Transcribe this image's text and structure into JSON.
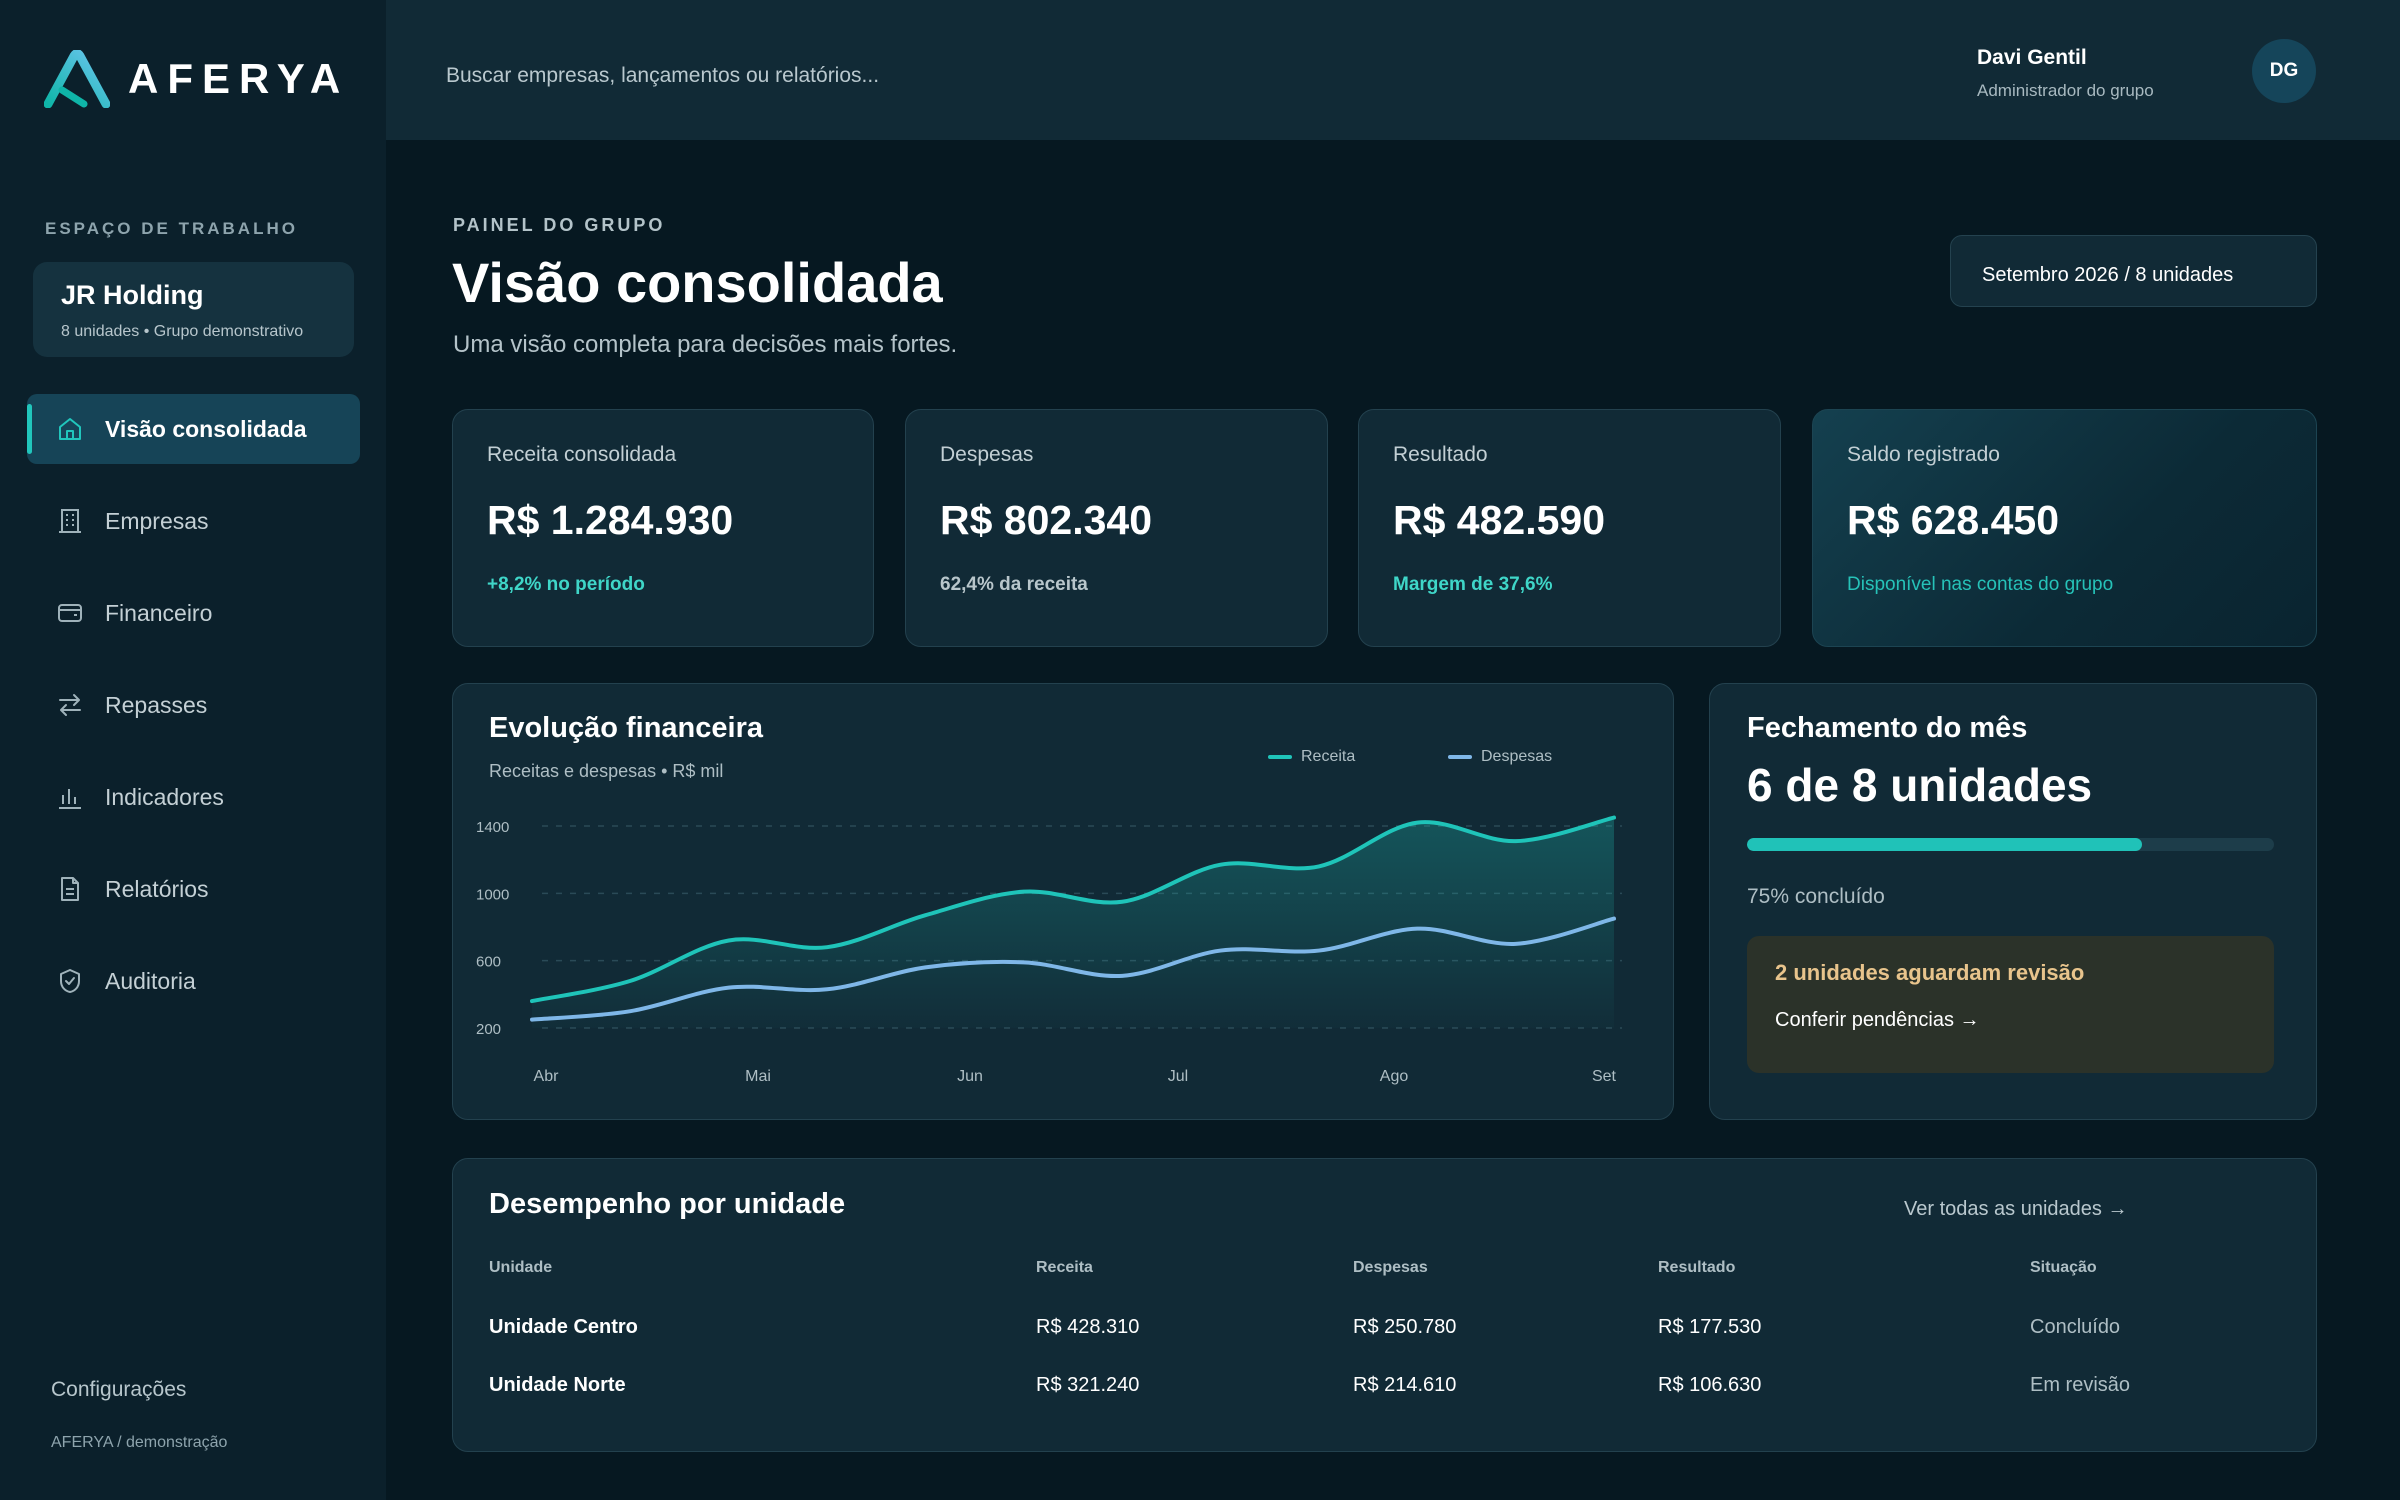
{
  "brand": {
    "name": "AFERYA",
    "accent": "#21c6bc"
  },
  "sidebar": {
    "workspace_label": "ESPAÇO DE TRABALHO",
    "workspace": {
      "name": "JR Holding",
      "subtitle": "8 unidades • Grupo demonstrativo"
    },
    "items": [
      {
        "label": "Visão consolidada",
        "icon": "home-icon",
        "active": true
      },
      {
        "label": "Empresas",
        "icon": "building-icon",
        "active": false
      },
      {
        "label": "Financeiro",
        "icon": "wallet-icon",
        "active": false
      },
      {
        "label": "Repasses",
        "icon": "transfer-icon",
        "active": false
      },
      {
        "label": "Indicadores",
        "icon": "bar-chart-icon",
        "active": false
      },
      {
        "label": "Relatórios",
        "icon": "document-icon",
        "active": false
      },
      {
        "label": "Auditoria",
        "icon": "shield-check-icon",
        "active": false
      }
    ],
    "settings_label": "Configurações",
    "footnote": "AFERYA / demonstração"
  },
  "topbar": {
    "search_placeholder": "Buscar empresas, lançamentos ou relatórios...",
    "user": {
      "name": "Davi Gentil",
      "role": "Administrador do grupo",
      "initials": "DG"
    }
  },
  "header": {
    "eyebrow": "PAINEL DO GRUPO",
    "title": "Visão consolidada",
    "subtitle": "Uma visão completa para decisões mais fortes.",
    "period": "Setembro 2026 / 8 unidades"
  },
  "kpis": [
    {
      "label": "Receita consolidada",
      "value": "R$ 1.284.930",
      "note": "+8,2% no período",
      "note_color": "#3fd6c8"
    },
    {
      "label": "Despesas",
      "value": "R$ 802.340",
      "note": "62,4% da receita",
      "note_color": "#b8c6cb"
    },
    {
      "label": "Resultado",
      "value": "R$ 482.590",
      "note": "Margem de 37,6%",
      "note_color": "#3fd6c8"
    },
    {
      "label": "Saldo registrado",
      "value": "R$ 628.450",
      "note": "Disponível nas contas do grupo",
      "note_color": "#26c2b8"
    }
  ],
  "chart": {
    "title": "Evolução financeira",
    "subtitle": "Receitas e despesas • R$ mil"
  },
  "chart_data": {
    "type": "line",
    "x": [
      "Abr",
      "Abr",
      "Mai",
      "Mai",
      "Jun",
      "Jun",
      "Jul",
      "Jul",
      "Ago",
      "Ago",
      "Set"
    ],
    "tick_labels": [
      "Abr",
      "Mai",
      "Jun",
      "Jul",
      "Ago",
      "Set"
    ],
    "y_ticks": [
      1400,
      1000,
      600,
      200
    ],
    "ylim": [
      200,
      1480
    ],
    "grid": true,
    "legend_position": "top-right",
    "series": [
      {
        "name": "Receita",
        "color": "#1fc4b9",
        "values": [
          360,
          480,
          720,
          680,
          870,
          1010,
          950,
          1170,
          1160,
          1420,
          1310,
          1450
        ]
      },
      {
        "name": "Despesas",
        "color": "#7fb7e8",
        "values": [
          250,
          300,
          440,
          430,
          560,
          590,
          510,
          660,
          660,
          790,
          700,
          850
        ]
      }
    ],
    "x_positions": [
      0,
      0.5,
      1,
      1.5,
      2,
      2.5,
      3,
      3.5,
      4,
      4.5,
      5,
      5.5
    ],
    "xlim": [
      0,
      5
    ]
  },
  "closing": {
    "title": "Fechamento do mês",
    "summary": "6 de 8 unidades",
    "progress": 0.75,
    "progress_label": "75% concluído",
    "alert_title": "2 unidades aguardam revisão",
    "alert_link": "Conferir pendências →"
  },
  "performance": {
    "title": "Desempenho por unidade",
    "view_all": "Ver todas as unidades →",
    "columns": [
      "Unidade",
      "Receita",
      "Despesas",
      "Resultado",
      "Situação"
    ],
    "rows": [
      [
        "Unidade Centro",
        "R$ 428.310",
        "R$ 250.780",
        "R$ 177.530",
        "Concluído"
      ],
      [
        "Unidade Norte",
        "R$ 321.240",
        "R$ 214.610",
        "R$ 106.630",
        "Em revisão"
      ]
    ]
  }
}
